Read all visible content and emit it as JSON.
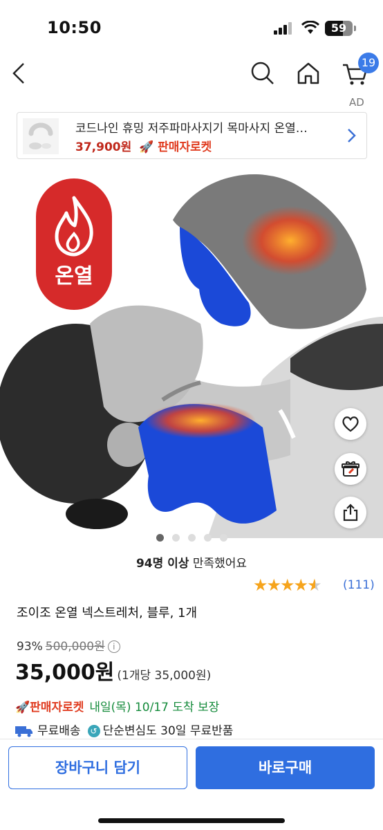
{
  "status_bar": {
    "time": "10:50",
    "battery": "59"
  },
  "nav": {
    "cart_count": "19",
    "ad_label": "AD"
  },
  "ad_banner": {
    "title": "코드나인 휴밍 저주파마사지기 목마사지 온열…",
    "price": "37,900원",
    "badge": "🚀 판매자로켓"
  },
  "hero": {
    "badge_text": "온열",
    "slide_count": 5,
    "active_slide": 0
  },
  "satisfaction": {
    "count": "94명 이상",
    "text": " 만족했어요"
  },
  "rating": {
    "stars": 4.5,
    "review_count": "(111)"
  },
  "product": {
    "name": "조이조 온열 넥스트레처, 블루, 1개",
    "discount": "93%",
    "original_price": "500,000원",
    "price": "35,000원",
    "unit_price": "(1개당 35,000원)"
  },
  "delivery": {
    "rocket": "🚀판매자로켓",
    "arrival": "내일(목) 10/17 도착 보장",
    "free_shipping": "무료배송",
    "free_return": "단순변심도 30일 무료반품"
  },
  "buttons": {
    "add_to_cart": "장바구니 담기",
    "buy_now": "바로구매"
  },
  "colors": {
    "accent": "#2f6ee0",
    "price_red": "#c0281b",
    "arrival_green": "#138a3a",
    "star": "#f6a41c"
  }
}
